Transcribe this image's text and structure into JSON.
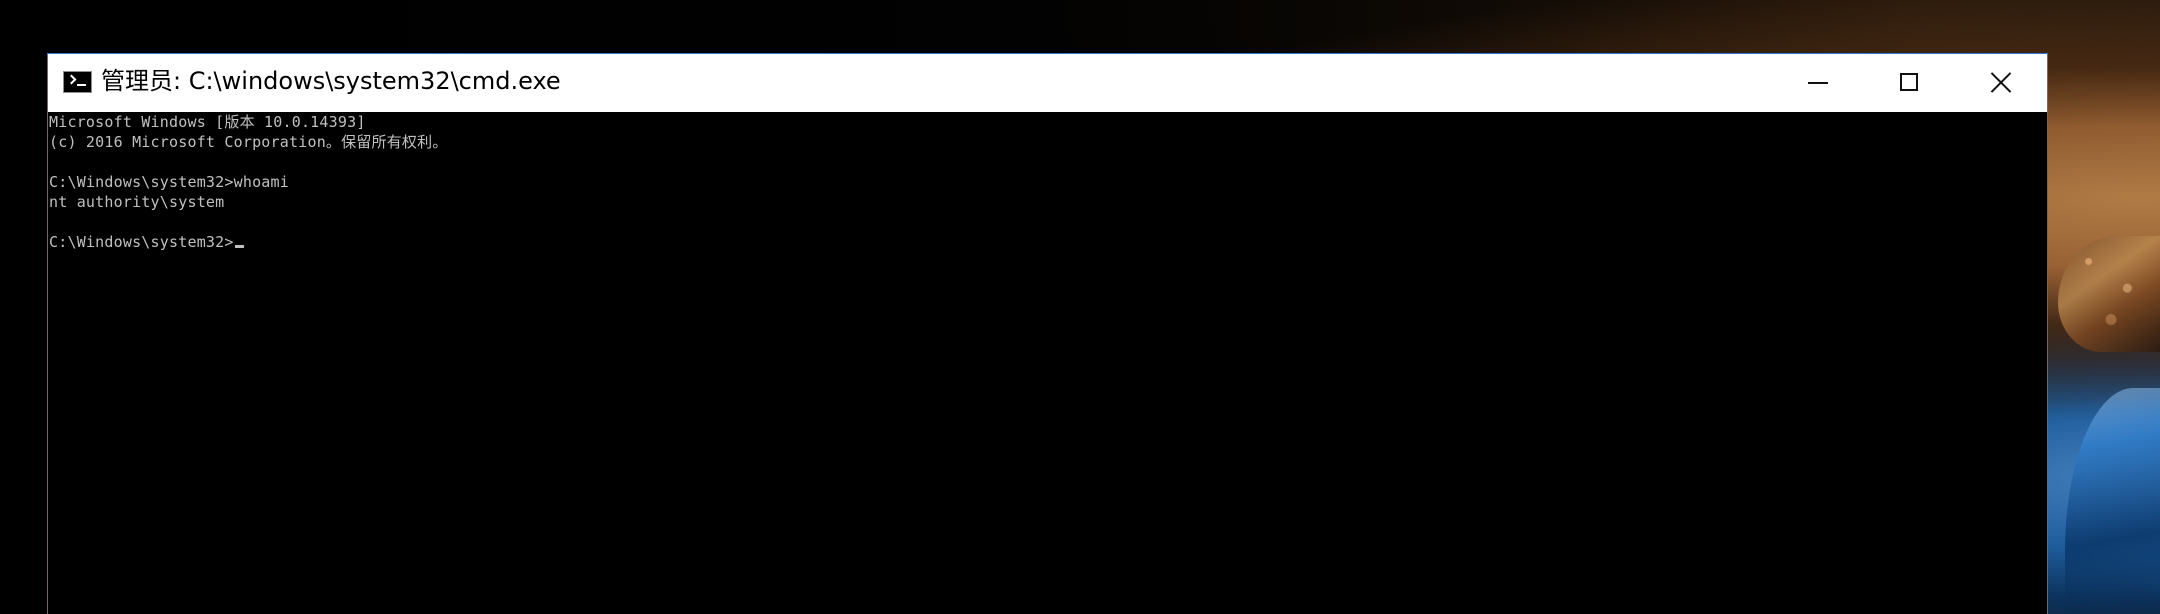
{
  "window": {
    "title": "管理员: C:\\windows\\system32\\cmd.exe",
    "icon": "command-prompt-icon",
    "border_color": "#2b79d0"
  },
  "caption_buttons": {
    "minimize": "minimize-icon",
    "maximize": "maximize-icon",
    "close": "close-icon"
  },
  "console": {
    "background_color": "#000000",
    "text_color": "#c0c0c0",
    "lines": [
      "Microsoft Windows [版本 10.0.14393]",
      "(c) 2016 Microsoft Corporation。保留所有权利。",
      "",
      "C:\\Windows\\system32>whoami",
      "nt authority\\system",
      "",
      "C:\\Windows\\system32>"
    ]
  }
}
